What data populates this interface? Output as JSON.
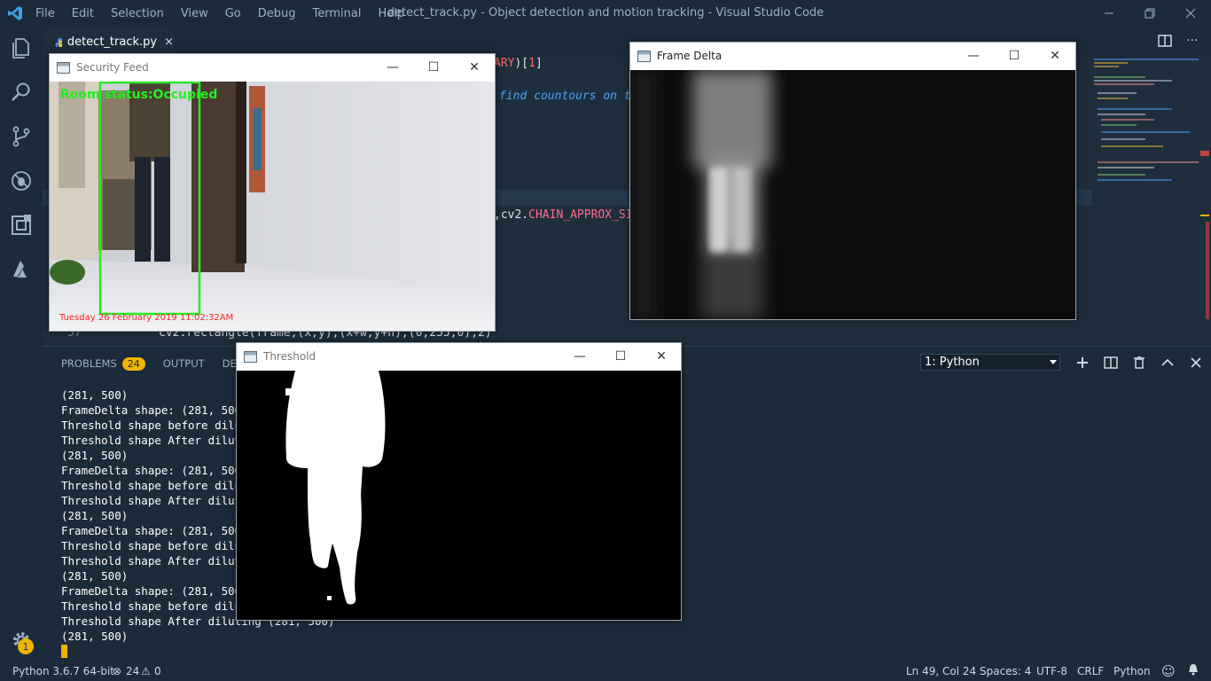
{
  "titlebar": {
    "menu": [
      "File",
      "Edit",
      "Selection",
      "View",
      "Go",
      "Debug",
      "Terminal",
      "Help"
    ],
    "title": "detect_track.py - Object detection and motion tracking - Visual Studio Code",
    "vscode_icon": "vscode-logo-icon"
  },
  "activitybar": {
    "icons": [
      "explorer-icon",
      "search-icon",
      "source-control-icon",
      "debug-icon",
      "extensions-icon",
      "azure-icon"
    ],
    "settings_badge": "1"
  },
  "editor": {
    "tab_label": "detect_track.py",
    "tab_close": "×",
    "visible_code": {
      "line_top_fragment": "ARY)[1]",
      "comment_fragment": "find countours on t",
      "chain_fragment": ",cv2.CHAIN_APPROX_SI",
      "line_number": "57",
      "rect_call": "cv2.rectangle(frame,(x,y),(x+w,y+h),(0,255,0),2)"
    }
  },
  "panel": {
    "tabs": [
      "PROBLEMS",
      "OUTPUT",
      "DEBUG"
    ],
    "problems_count": "24",
    "terminal_select": "1: Python",
    "terminal_lines": [
      "(281, 500)",
      "FrameDelta shape: (281, 500)",
      "Threshold shape before diluting (281, 500)",
      "Threshold shape After diluting (281, 500)",
      "(281, 500)",
      "FrameDelta shape: (281, 500)",
      "Threshold shape before diluting (281, 500)",
      "Threshold shape After diluting (281, 500)",
      "(281, 500)",
      "FrameDelta shape: (281, 500)",
      "Threshold shape before diluting (281, 500)",
      "Threshold shape After diluting (281, 500)",
      "(281, 500)",
      "FrameDelta shape: (281, 500)",
      "Threshold shape before diluting (281, 500)",
      "Threshold shape After diluting (281, 500)",
      "(281, 500)"
    ]
  },
  "statusbar": {
    "python_env": "Python 3.6.7 64-bit",
    "errors": "24",
    "warnings": "0",
    "position": "Ln 49, Col 24",
    "spaces": "Spaces: 4",
    "encoding": "UTF-8",
    "eol": "CRLF",
    "language": "Python"
  },
  "windows": {
    "security_feed": {
      "title": "Security Feed",
      "overlay_status": "Room status:Occupied",
      "timestamp": "Tuesday 26 February 2019 11:02:32AM"
    },
    "frame_delta": {
      "title": "Frame Delta"
    },
    "threshold": {
      "title": "Threshold"
    },
    "controls": {
      "minimize": "—",
      "maximize": "☐",
      "close": "✕"
    }
  },
  "colors": {
    "accent": "#f0b400",
    "detection_box": "#22ee22",
    "timestamp_text": "#ff2020",
    "background": "#1e2e3d"
  }
}
